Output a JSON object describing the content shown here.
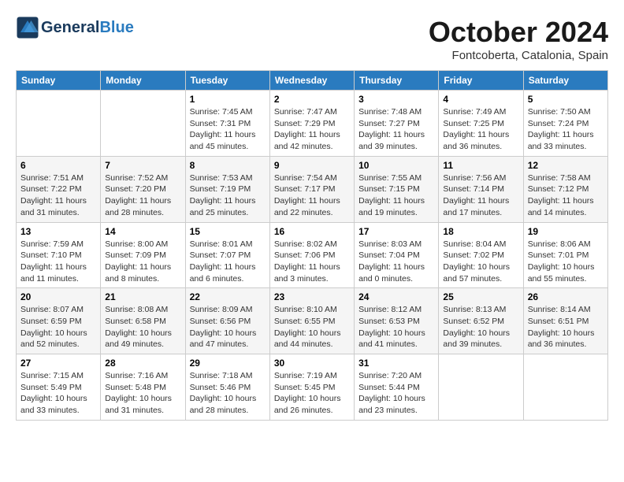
{
  "header": {
    "logo_general": "General",
    "logo_blue": "Blue",
    "month": "October 2024",
    "location": "Fontcoberta, Catalonia, Spain"
  },
  "weekdays": [
    "Sunday",
    "Monday",
    "Tuesday",
    "Wednesday",
    "Thursday",
    "Friday",
    "Saturday"
  ],
  "weeks": [
    [
      {
        "day": "",
        "info": ""
      },
      {
        "day": "",
        "info": ""
      },
      {
        "day": "1",
        "info": "Sunrise: 7:45 AM\nSunset: 7:31 PM\nDaylight: 11 hours and 45 minutes."
      },
      {
        "day": "2",
        "info": "Sunrise: 7:47 AM\nSunset: 7:29 PM\nDaylight: 11 hours and 42 minutes."
      },
      {
        "day": "3",
        "info": "Sunrise: 7:48 AM\nSunset: 7:27 PM\nDaylight: 11 hours and 39 minutes."
      },
      {
        "day": "4",
        "info": "Sunrise: 7:49 AM\nSunset: 7:25 PM\nDaylight: 11 hours and 36 minutes."
      },
      {
        "day": "5",
        "info": "Sunrise: 7:50 AM\nSunset: 7:24 PM\nDaylight: 11 hours and 33 minutes."
      }
    ],
    [
      {
        "day": "6",
        "info": "Sunrise: 7:51 AM\nSunset: 7:22 PM\nDaylight: 11 hours and 31 minutes."
      },
      {
        "day": "7",
        "info": "Sunrise: 7:52 AM\nSunset: 7:20 PM\nDaylight: 11 hours and 28 minutes."
      },
      {
        "day": "8",
        "info": "Sunrise: 7:53 AM\nSunset: 7:19 PM\nDaylight: 11 hours and 25 minutes."
      },
      {
        "day": "9",
        "info": "Sunrise: 7:54 AM\nSunset: 7:17 PM\nDaylight: 11 hours and 22 minutes."
      },
      {
        "day": "10",
        "info": "Sunrise: 7:55 AM\nSunset: 7:15 PM\nDaylight: 11 hours and 19 minutes."
      },
      {
        "day": "11",
        "info": "Sunrise: 7:56 AM\nSunset: 7:14 PM\nDaylight: 11 hours and 17 minutes."
      },
      {
        "day": "12",
        "info": "Sunrise: 7:58 AM\nSunset: 7:12 PM\nDaylight: 11 hours and 14 minutes."
      }
    ],
    [
      {
        "day": "13",
        "info": "Sunrise: 7:59 AM\nSunset: 7:10 PM\nDaylight: 11 hours and 11 minutes."
      },
      {
        "day": "14",
        "info": "Sunrise: 8:00 AM\nSunset: 7:09 PM\nDaylight: 11 hours and 8 minutes."
      },
      {
        "day": "15",
        "info": "Sunrise: 8:01 AM\nSunset: 7:07 PM\nDaylight: 11 hours and 6 minutes."
      },
      {
        "day": "16",
        "info": "Sunrise: 8:02 AM\nSunset: 7:06 PM\nDaylight: 11 hours and 3 minutes."
      },
      {
        "day": "17",
        "info": "Sunrise: 8:03 AM\nSunset: 7:04 PM\nDaylight: 11 hours and 0 minutes."
      },
      {
        "day": "18",
        "info": "Sunrise: 8:04 AM\nSunset: 7:02 PM\nDaylight: 10 hours and 57 minutes."
      },
      {
        "day": "19",
        "info": "Sunrise: 8:06 AM\nSunset: 7:01 PM\nDaylight: 10 hours and 55 minutes."
      }
    ],
    [
      {
        "day": "20",
        "info": "Sunrise: 8:07 AM\nSunset: 6:59 PM\nDaylight: 10 hours and 52 minutes."
      },
      {
        "day": "21",
        "info": "Sunrise: 8:08 AM\nSunset: 6:58 PM\nDaylight: 10 hours and 49 minutes."
      },
      {
        "day": "22",
        "info": "Sunrise: 8:09 AM\nSunset: 6:56 PM\nDaylight: 10 hours and 47 minutes."
      },
      {
        "day": "23",
        "info": "Sunrise: 8:10 AM\nSunset: 6:55 PM\nDaylight: 10 hours and 44 minutes."
      },
      {
        "day": "24",
        "info": "Sunrise: 8:12 AM\nSunset: 6:53 PM\nDaylight: 10 hours and 41 minutes."
      },
      {
        "day": "25",
        "info": "Sunrise: 8:13 AM\nSunset: 6:52 PM\nDaylight: 10 hours and 39 minutes."
      },
      {
        "day": "26",
        "info": "Sunrise: 8:14 AM\nSunset: 6:51 PM\nDaylight: 10 hours and 36 minutes."
      }
    ],
    [
      {
        "day": "27",
        "info": "Sunrise: 7:15 AM\nSunset: 5:49 PM\nDaylight: 10 hours and 33 minutes."
      },
      {
        "day": "28",
        "info": "Sunrise: 7:16 AM\nSunset: 5:48 PM\nDaylight: 10 hours and 31 minutes."
      },
      {
        "day": "29",
        "info": "Sunrise: 7:18 AM\nSunset: 5:46 PM\nDaylight: 10 hours and 28 minutes."
      },
      {
        "day": "30",
        "info": "Sunrise: 7:19 AM\nSunset: 5:45 PM\nDaylight: 10 hours and 26 minutes."
      },
      {
        "day": "31",
        "info": "Sunrise: 7:20 AM\nSunset: 5:44 PM\nDaylight: 10 hours and 23 minutes."
      },
      {
        "day": "",
        "info": ""
      },
      {
        "day": "",
        "info": ""
      }
    ]
  ]
}
